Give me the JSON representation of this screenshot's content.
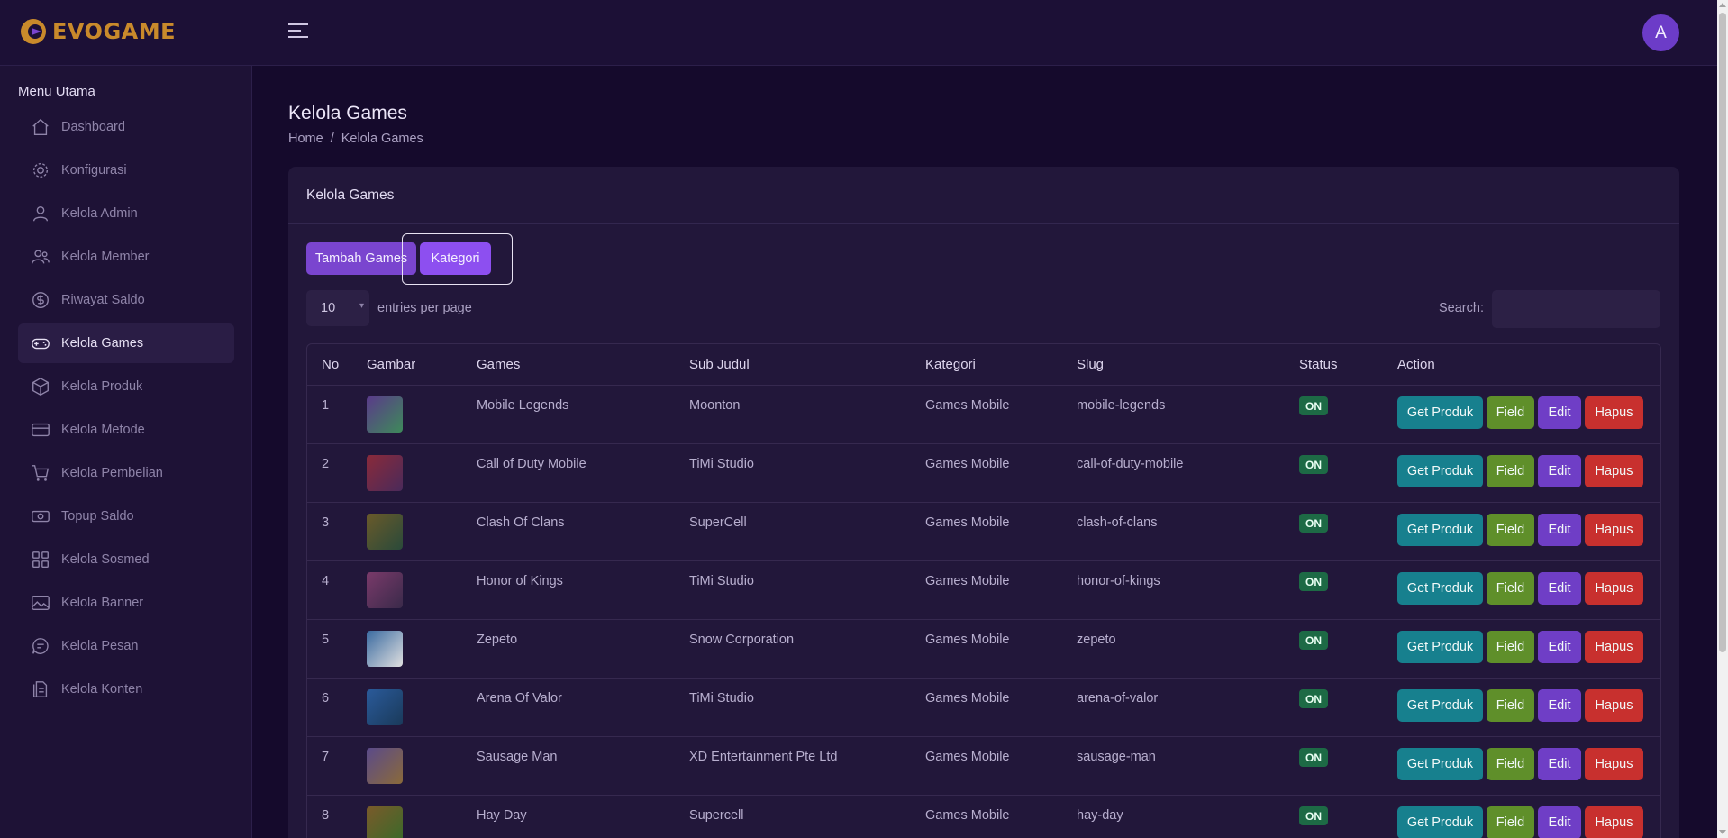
{
  "brand": {
    "name": "EVOGAME",
    "logo_color": "#c98a2b"
  },
  "topbar": {
    "avatar_initial": "A"
  },
  "sidebar": {
    "heading": "Menu Utama",
    "items": [
      {
        "label": "Dashboard",
        "icon": "home-icon"
      },
      {
        "label": "Konfigurasi",
        "icon": "gear-icon"
      },
      {
        "label": "Kelola Admin",
        "icon": "user-icon"
      },
      {
        "label": "Kelola Member",
        "icon": "users-icon"
      },
      {
        "label": "Riwayat Saldo",
        "icon": "dollar-icon"
      },
      {
        "label": "Kelola Games",
        "icon": "gamepad-icon",
        "active": true
      },
      {
        "label": "Kelola Produk",
        "icon": "box-icon"
      },
      {
        "label": "Kelola Metode",
        "icon": "card-icon"
      },
      {
        "label": "Kelola Pembelian",
        "icon": "cart-icon"
      },
      {
        "label": "Topup Saldo",
        "icon": "money-icon"
      },
      {
        "label": "Kelola Sosmed",
        "icon": "grid-icon"
      },
      {
        "label": "Kelola Banner",
        "icon": "image-icon"
      },
      {
        "label": "Kelola Pesan",
        "icon": "chat-icon"
      },
      {
        "label": "Kelola Konten",
        "icon": "document-icon"
      }
    ]
  },
  "page": {
    "title": "Kelola Games",
    "breadcrumb": {
      "home": "Home",
      "separator": "/",
      "current": "Kelola Games"
    }
  },
  "card": {
    "title": "Kelola Games",
    "add_button": "Tambah Games",
    "category_button": "Kategori",
    "entries_value": "10",
    "entries_label": "entries per page",
    "search_label": "Search:",
    "search_value": ""
  },
  "table": {
    "headers": [
      "No",
      "Gambar",
      "Games",
      "Sub Judul",
      "Kategori",
      "Slug",
      "Status",
      "Action"
    ],
    "action_labels": {
      "get": "Get Produk",
      "field": "Field",
      "edit": "Edit",
      "delete": "Hapus"
    },
    "rows": [
      {
        "no": "1",
        "game": "Mobile Legends",
        "sub": "Moonton",
        "kategori": "Games Mobile",
        "slug": "mobile-legends",
        "status": "ON"
      },
      {
        "no": "2",
        "game": "Call of Duty Mobile",
        "sub": "TiMi Studio",
        "kategori": "Games Mobile",
        "slug": "call-of-duty-mobile",
        "status": "ON"
      },
      {
        "no": "3",
        "game": "Clash Of Clans",
        "sub": "SuperCell",
        "kategori": "Games Mobile",
        "slug": "clash-of-clans",
        "status": "ON"
      },
      {
        "no": "4",
        "game": "Honor of Kings",
        "sub": "TiMi Studio",
        "kategori": "Games Mobile",
        "slug": "honor-of-kings",
        "status": "ON"
      },
      {
        "no": "5",
        "game": "Zepeto",
        "sub": "Snow Corporation",
        "kategori": "Games Mobile",
        "slug": "zepeto",
        "status": "ON"
      },
      {
        "no": "6",
        "game": "Arena Of Valor",
        "sub": "TiMi Studio",
        "kategori": "Games Mobile",
        "slug": "arena-of-valor",
        "status": "ON"
      },
      {
        "no": "7",
        "game": "Sausage Man",
        "sub": "XD Entertainment Pte Ltd",
        "kategori": "Games Mobile",
        "slug": "sausage-man",
        "status": "ON"
      },
      {
        "no": "8",
        "game": "Hay Day",
        "sub": "Supercell",
        "kategori": "Games Mobile",
        "slug": "hay-day",
        "status": "ON"
      }
    ]
  },
  "colors": {
    "accent": "#8d4ff0",
    "status_on": "#1d6a45",
    "get_produk": "#17808e",
    "field": "#5f8f2a",
    "edit": "#6f3ec6",
    "hapus": "#c8302e"
  }
}
